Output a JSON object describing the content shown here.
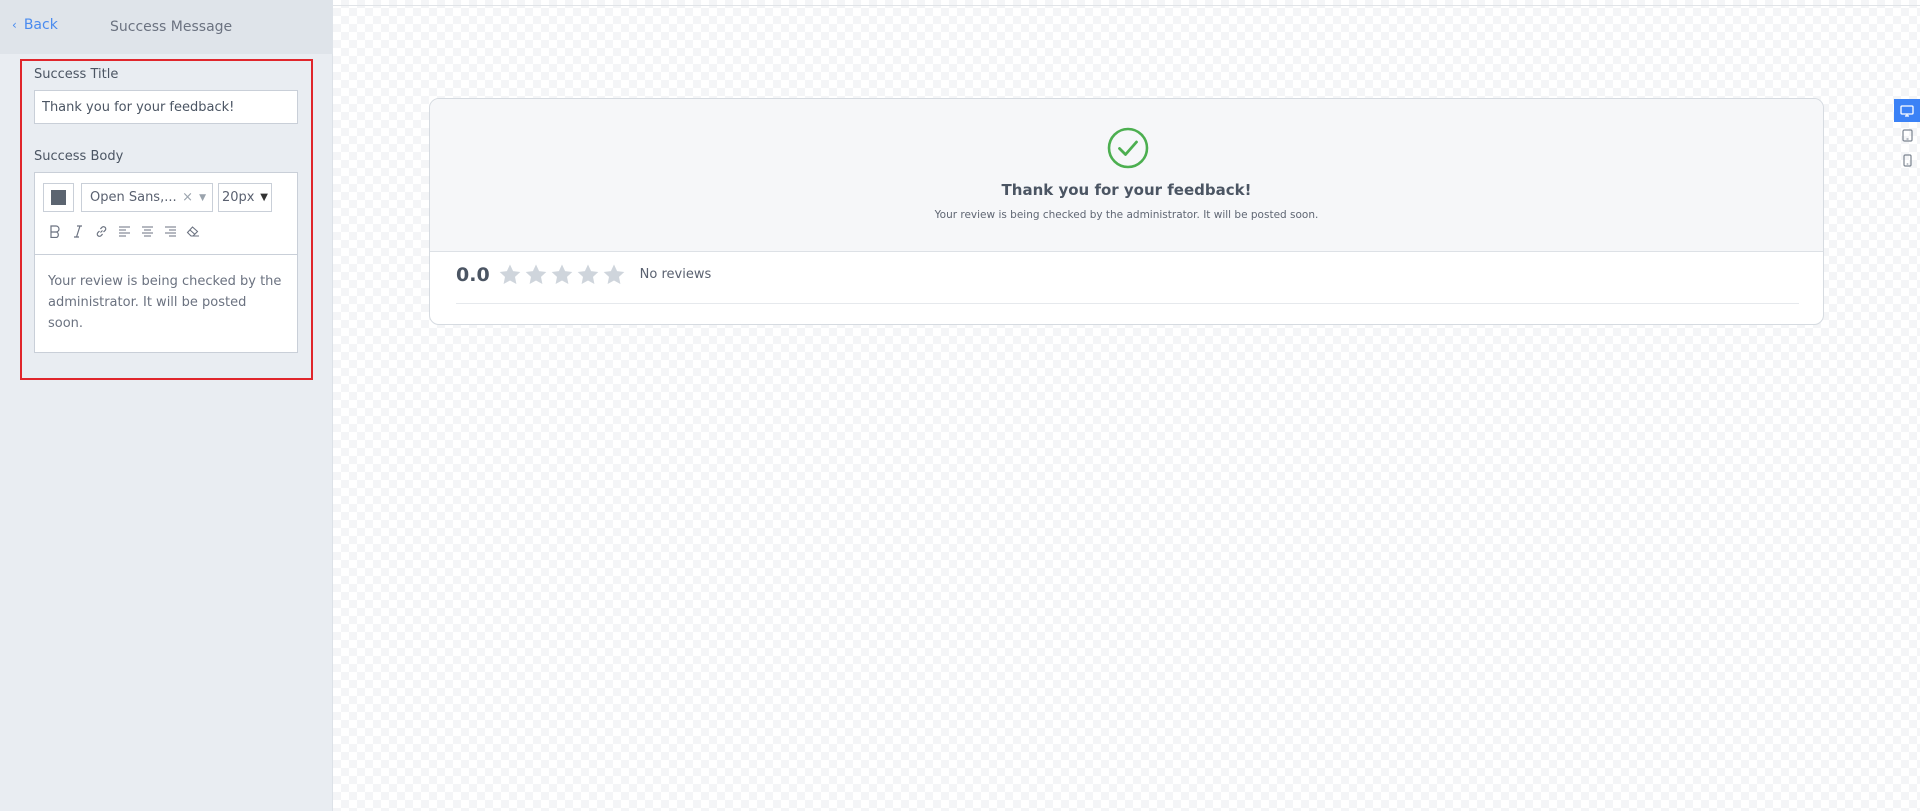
{
  "sidebar": {
    "back_label": "Back",
    "panel_title": "Success Message",
    "success_title_label": "Success Title",
    "success_title_value": "Thank you for your feedback!",
    "success_body_label": "Success Body",
    "editor": {
      "text_color": "#5b6470",
      "font_value": "Open Sans,...",
      "font_size_value": "20px",
      "body_text": "Your review is being checked by the administrator. It will be posted soon."
    }
  },
  "preview": {
    "success_title": "Thank you for your feedback!",
    "success_body": "Your review is being checked by the administrator. It will be posted soon.",
    "rating_value": "0.0",
    "reviews_label": "No reviews",
    "stars_total": 5,
    "stars_filled": 0,
    "check_color": "#4caf50"
  },
  "device_switcher": {
    "active": "desktop",
    "accent_color": "#3b82f6"
  }
}
